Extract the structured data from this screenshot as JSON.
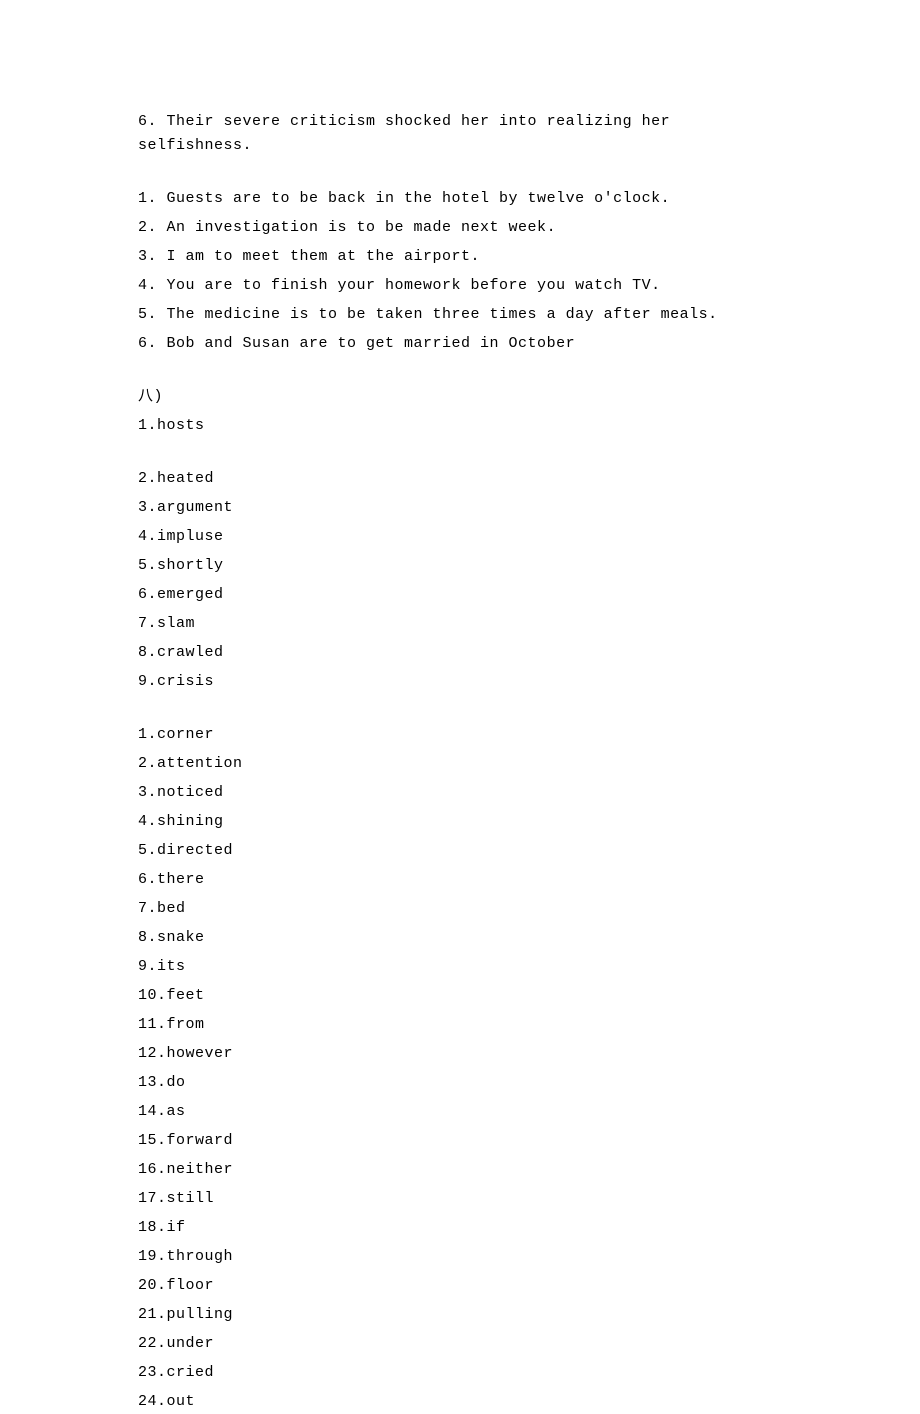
{
  "block1": [
    "6. Their severe criticism shocked her into realizing her selfishness."
  ],
  "block2": [
    "1. Guests are to be back in the hotel by twelve o'clock.",
    "2. An investigation is to be made next week.",
    "3. I am to meet them at the airport.",
    "4. You are to finish your homework before you watch TV.",
    "5. The medicine is to be taken three times a day after meals.",
    "6. Bob and Susan are to get married in October"
  ],
  "section8_header": "八)",
  "block3": [
    "1.hosts"
  ],
  "block4": [
    "2.heated",
    "3.argument",
    "4.impluse",
    "5.shortly",
    "6.emerged",
    "7.slam",
    "8.crawled",
    "9.crisis"
  ],
  "block5": [
    "1.corner",
    "2.attention",
    "3.noticed",
    "4.shining",
    "5.directed",
    "6.there",
    "7.bed",
    "8.snake",
    "9.its",
    "10.feet",
    "11.from",
    "12.however",
    "13.do",
    "14.as",
    "15.forward",
    "16.neither",
    "17.still",
    "18.if",
    "19.through",
    "20.floor",
    "21.pulling",
    "22.under",
    "23.cried",
    "24.out"
  ]
}
